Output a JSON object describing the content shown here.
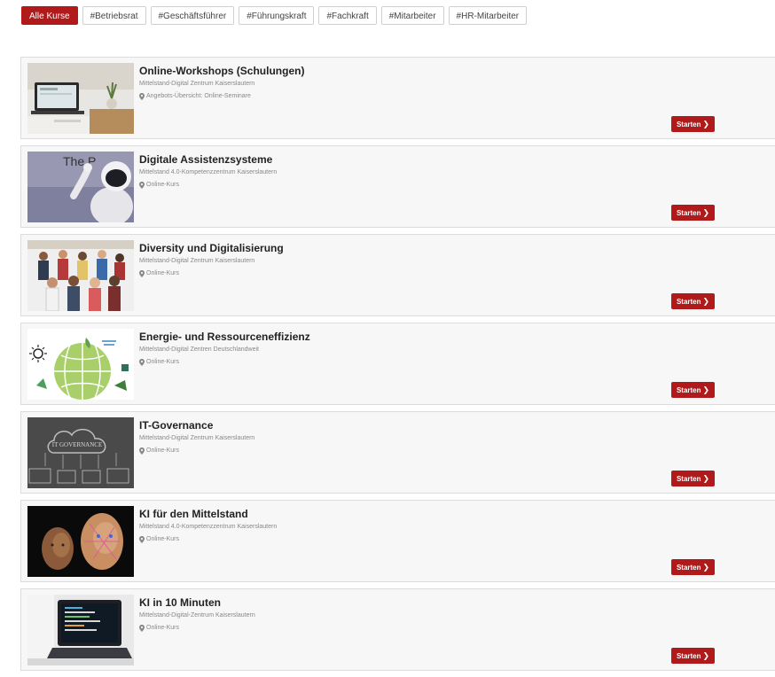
{
  "filters": [
    {
      "label": "Alle Kurse",
      "active": true
    },
    {
      "label": "#Betriebsrat",
      "active": false
    },
    {
      "label": "#Geschäftsführer",
      "active": false
    },
    {
      "label": "#Führungskraft",
      "active": false
    },
    {
      "label": "#Fachkraft",
      "active": false
    },
    {
      "label": "#Mitarbeiter",
      "active": false
    },
    {
      "label": "#HR-Mitarbeiter",
      "active": false
    }
  ],
  "courses": [
    {
      "title": "Online-Workshops (Schulungen)",
      "org": "Mittelstand-Digital Zentrum Kaiserslautern",
      "meta": "Angebots-Übersicht: Online-Seminare",
      "button": "Starten",
      "image_text": ""
    },
    {
      "title": "Digitale Assistenzsysteme",
      "org": "Mittelstand 4.0-Kompetenzzentrum Kaiserslautern",
      "meta": "Online-Kurs",
      "button": "Starten",
      "image_text": "The P"
    },
    {
      "title": "Diversity und Digitalisierung",
      "org": "Mittelstand-Digital Zentrum Kaiserslautern",
      "meta": "Online-Kurs",
      "button": "Starten",
      "image_text": ""
    },
    {
      "title": "Energie- und Ressourceneffizienz",
      "org": "Mittelstand-Digital Zentren Deutschlandweit",
      "meta": "Online-Kurs",
      "button": "Starten",
      "image_text": ""
    },
    {
      "title": "IT-Governance",
      "org": "Mittelstand-Digital Zentrum Kaiserslautern",
      "meta": "Online-Kurs",
      "button": "Starten",
      "image_text": "IT GOVERNANCE"
    },
    {
      "title": "KI für den Mittelstand",
      "org": "Mittelstand 4.0-Kompetenzzentrum Kaiserslautern",
      "meta": "Online-Kurs",
      "button": "Starten",
      "image_text": ""
    },
    {
      "title": "KI in 10 Minuten",
      "org": "Mittelstand-Digital-Zentrum Kaiserslautern",
      "meta": "Online-Kurs",
      "button": "Starten",
      "image_text": ""
    }
  ],
  "colors": {
    "accent": "#b01a1a",
    "card_bg": "#f7f7f7",
    "border": "#dcdcdc"
  },
  "icons": {
    "location": "map-pin-icon",
    "button_chevron": "chevron-right-icon"
  }
}
